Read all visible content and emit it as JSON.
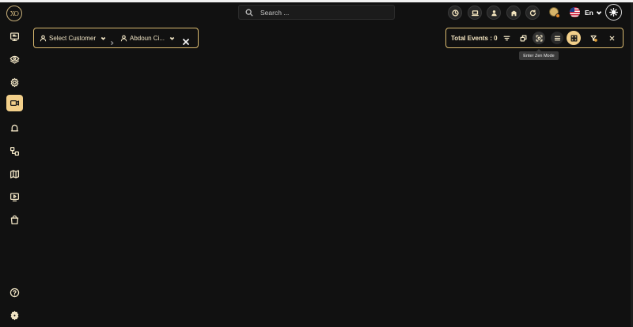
{
  "header": {
    "search": {
      "placeholder": "Search ...",
      "value": ""
    },
    "toolbar_icons": [
      "clock-icon",
      "laptop-icon",
      "user-icon",
      "building-icon",
      "refresh-icon"
    ],
    "language": {
      "label": "En",
      "flag": "us-flag-icon"
    },
    "theme_icon": "sun-icon"
  },
  "sidebar": {
    "logo_text": "XO",
    "items": [
      {
        "name": "dashboard",
        "icon": "monitor-chat-icon",
        "active": false
      },
      {
        "name": "vision",
        "icon": "eye-layers-icon",
        "active": false
      },
      {
        "name": "settings",
        "icon": "gear-outline-icon",
        "active": false
      },
      {
        "name": "video",
        "icon": "video-camera-icon",
        "active": true
      },
      {
        "name": "alarms",
        "icon": "bell-box-icon",
        "active": false
      },
      {
        "name": "workflow",
        "icon": "nodes-icon",
        "active": false
      },
      {
        "name": "map",
        "icon": "map-icon",
        "active": false
      },
      {
        "name": "playback",
        "icon": "play-screen-icon",
        "active": false
      },
      {
        "name": "store",
        "icon": "shopping-bag-icon",
        "active": false
      }
    ],
    "bottom": [
      {
        "name": "help",
        "icon": "help-circle-icon"
      },
      {
        "name": "preferences",
        "icon": "gear-filled-icon"
      }
    ]
  },
  "customer_bar": {
    "customer_label": "Select Customer",
    "site_label": "Abdoun Ci..."
  },
  "events_bar": {
    "total_label": "Total Events : 0",
    "icons": [
      "filter-icon",
      "restore-window-icon",
      "zen-mode-icon",
      "list-view-icon",
      "grid-view-icon",
      "filter-clear-icon",
      "close-icon"
    ],
    "tooltip": "Enter Zen Mode"
  },
  "colors": {
    "accent": "#f2cf8a",
    "border": "#d9b96f",
    "background": "#111111"
  }
}
